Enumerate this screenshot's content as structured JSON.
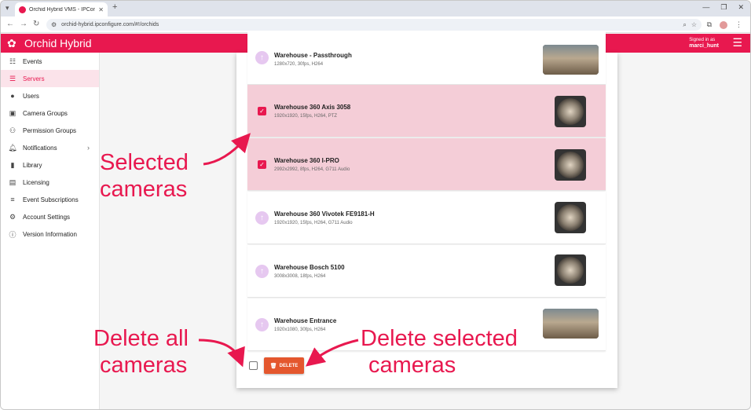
{
  "browser": {
    "tab_title": "Orchid Hybrid VMS - IPConfig...",
    "url": "orchid-hybrid.ipconfigure.com/#!/orchids"
  },
  "app": {
    "title": "Orchid Hybrid",
    "signed_in_label": "Signed in as",
    "username": "marci_hunt"
  },
  "sidebar": {
    "items": [
      {
        "label": "Events",
        "icon": "events-icon"
      },
      {
        "label": "Servers",
        "icon": "servers-icon",
        "active": true
      },
      {
        "label": "Users",
        "icon": "user-icon"
      },
      {
        "label": "Camera Groups",
        "icon": "camera-groups-icon"
      },
      {
        "label": "Permission Groups",
        "icon": "permission-groups-icon"
      },
      {
        "label": "Notifications",
        "icon": "bell-icon"
      },
      {
        "label": "Library",
        "icon": "bookmark-icon"
      },
      {
        "label": "Licensing",
        "icon": "license-icon"
      },
      {
        "label": "Event Subscriptions",
        "icon": "subscriptions-icon"
      },
      {
        "label": "Account Settings",
        "icon": "account-settings-icon"
      },
      {
        "label": "Version Information",
        "icon": "info-icon"
      }
    ]
  },
  "cameras": [
    {
      "name": "Warehouse - Passthrough",
      "spec": "1280x720, 30fps, H264",
      "selected": false
    },
    {
      "name": "Warehouse 360 Axis 3058",
      "spec": "1920x1920, 15fps, H264, PTZ",
      "selected": true
    },
    {
      "name": "Warehouse 360 I-PRO",
      "spec": "2992x2992, 8fps, H264, G711 Audio",
      "selected": true
    },
    {
      "name": "Warehouse 360 Vivotek FE9181-H",
      "spec": "1920x1920, 15fps, H264, G711 Audio",
      "selected": false
    },
    {
      "name": "Warehouse Bosch 5100",
      "spec": "3008x3008, 18fps, H264",
      "selected": false
    },
    {
      "name": "Warehouse Entrance",
      "spec": "1920x1080, 30fps, H264",
      "selected": false
    }
  ],
  "actions": {
    "delete_label": "DELETE"
  },
  "annotations": {
    "selected_line1": "Selected",
    "selected_line2": "cameras",
    "delete_all_line1": "Delete all",
    "delete_all_line2": "cameras",
    "delete_selected_line1": "Delete selected",
    "delete_selected_line2": "cameras"
  },
  "colors": {
    "brand": "#e8184f",
    "selected_row": "#f4cdd7",
    "delete_button": "#e4572e"
  }
}
